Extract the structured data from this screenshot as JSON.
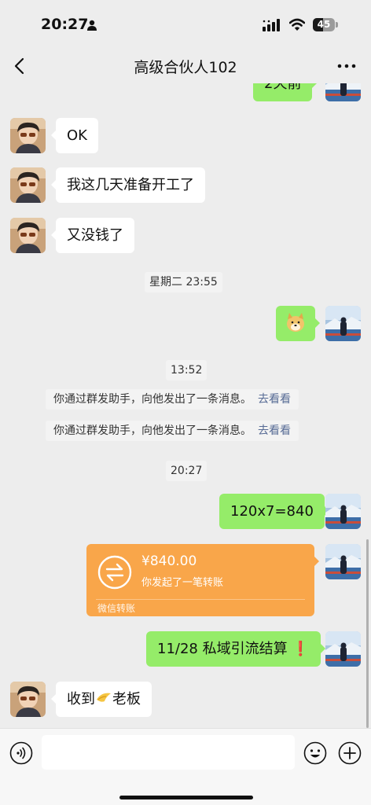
{
  "status_bar": {
    "time": "20:27",
    "battery_level": "45",
    "icons": [
      "person-icon",
      "signal-icon",
      "wifi-icon",
      "battery-icon"
    ]
  },
  "nav": {
    "title": "高级合伙人102",
    "icons": [
      "back-icon",
      "more-icon"
    ]
  },
  "messages": {
    "partial_top": "2天前",
    "ok": "OK",
    "start_work": "我这几天准备开工了",
    "no_money": "又没钱了",
    "ts_tuesday": "星期二 23:55",
    "sticker": "doge-sticker",
    "ts_1352": "13:52",
    "notice_1": "你通过群发助手，向他发出了一条消息。",
    "notice_1_link": "去看看",
    "notice_2": "你通过群发助手，向他发出了一条消息。",
    "notice_2_link": "去看看",
    "ts_2027": "20:27",
    "calc": "120x7=840",
    "transfer": {
      "amount": "¥840.00",
      "desc": "你发起了一笔转账",
      "footer": "微信转账",
      "color": "#f9a64a"
    },
    "settlement_text": "11/28 私域引流结算",
    "settlement_mark": "❗",
    "received_a": "收到",
    "received_b": "老板"
  },
  "input_bar": {
    "placeholder": "",
    "icons": [
      "voice-icon",
      "emoji-icon",
      "plus-icon"
    ]
  },
  "colors": {
    "sent_bubble": "#95ec69",
    "received_bubble": "#ffffff",
    "background": "#ededed",
    "link": "#576b95"
  }
}
